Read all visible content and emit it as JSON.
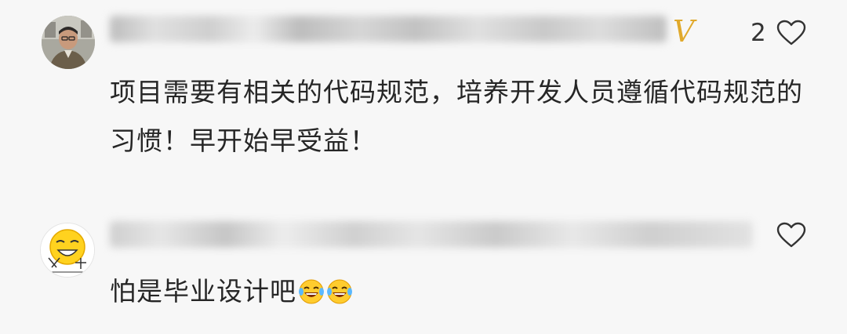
{
  "comments": [
    {
      "like_count": "2",
      "verified_badge": "V",
      "text": "项目需要有相关的代码规范，培养开发人员遵循代码规范的习惯！早开始早受益！",
      "colors": {
        "badge": "#e0a92c"
      }
    },
    {
      "like_count": "",
      "text": "怕是毕业设计吧",
      "emojis": [
        "laughing-tears-icon",
        "laughing-tears-icon"
      ]
    }
  ],
  "colors": {
    "background": "#f7f7f7",
    "text": "#262626",
    "icon": "#333333"
  }
}
